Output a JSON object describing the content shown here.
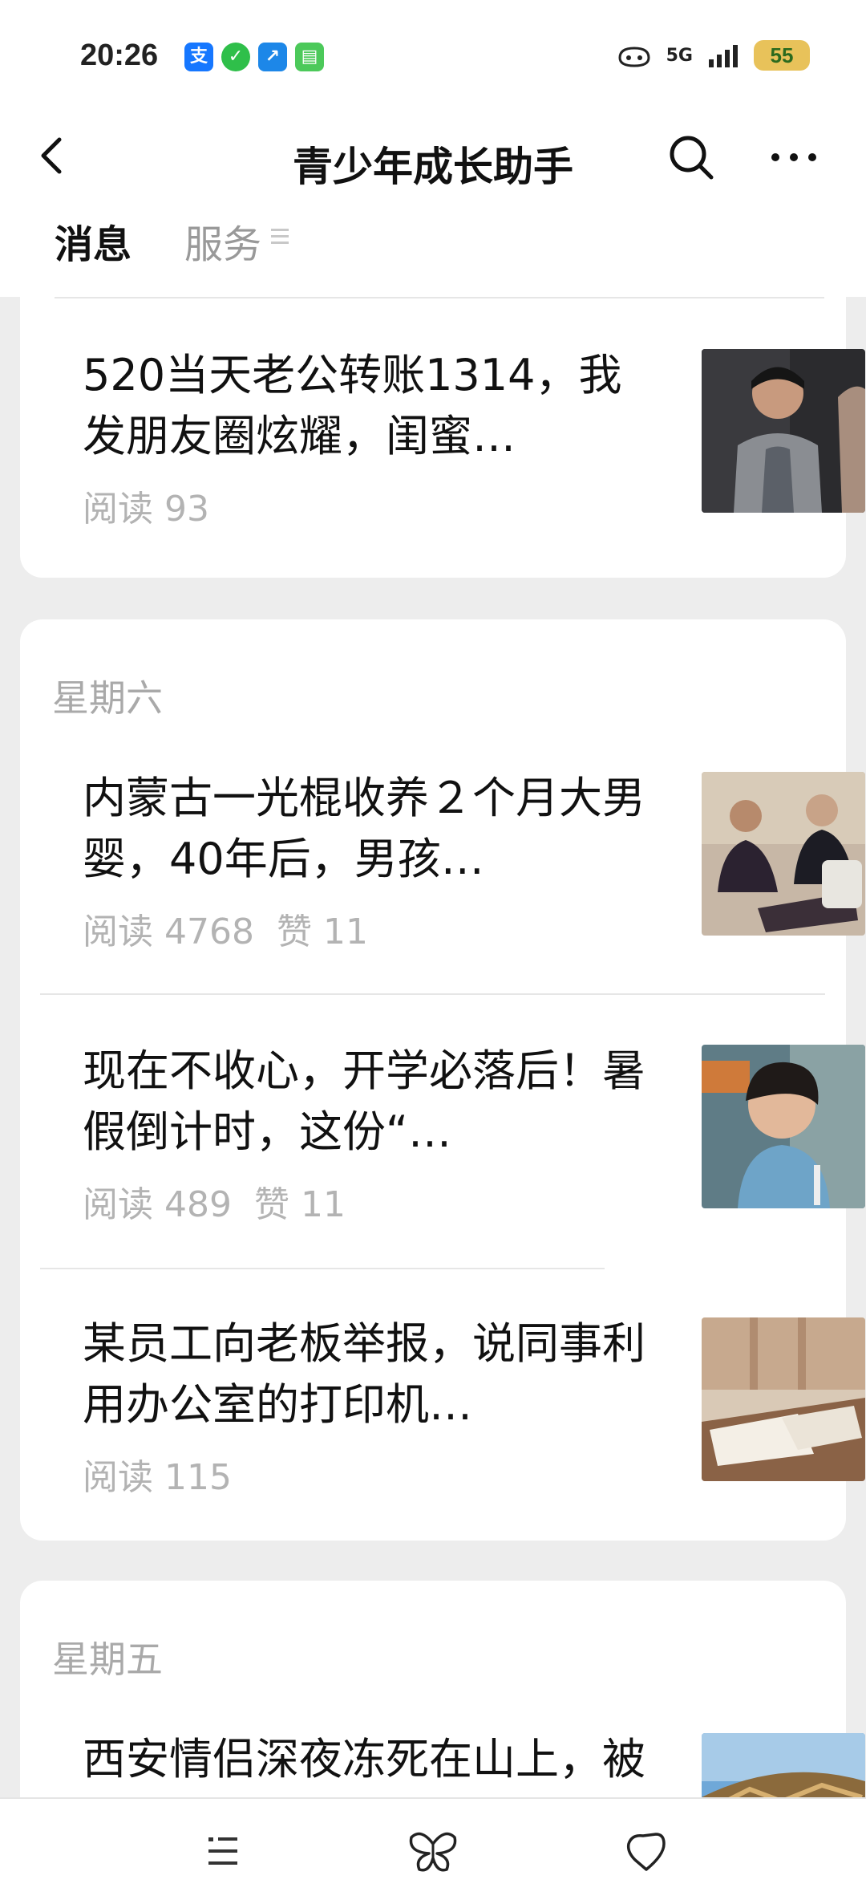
{
  "status_bar": {
    "time": "20:26",
    "apps": [
      {
        "icon": "alipay-icon",
        "glyph": "支",
        "color": "#1677ff"
      },
      {
        "icon": "shield-icon",
        "glyph": "✓",
        "color": "#2fbf4a"
      },
      {
        "icon": "pointer-app-icon",
        "glyph": "↗",
        "color": "#1d87e8"
      },
      {
        "icon": "message-app-icon",
        "glyph": "▤",
        "color": "#4cc95a"
      }
    ],
    "network_label": "5G",
    "battery": "55"
  },
  "nav": {
    "title": "青少年成长助手"
  },
  "tabs": {
    "messages": "消息",
    "services": "服务"
  },
  "cards": [
    {
      "day": "",
      "articles": [
        {
          "title": "520当天老公转账1314，我发朋友圈炫耀，闺蜜…",
          "reads": "阅读 93",
          "likes": "",
          "thumb": "couple-photo"
        }
      ]
    },
    {
      "day": "星期六",
      "articles": [
        {
          "title": "内蒙古一光棍收养２个月大男婴，40年后，男孩…",
          "reads": "阅读 4768",
          "likes": "赞 11",
          "thumb": "elder-and-man-photo"
        },
        {
          "title": "现在不收心，开学必落后！暑假倒计时，这份“…",
          "reads": "阅读 489",
          "likes": "赞 11",
          "thumb": "child-photo"
        },
        {
          "title": "某员工向老板举报，说同事利用办公室的打印机…",
          "reads": "阅读 115",
          "likes": "",
          "thumb": "office-desk-photo"
        }
      ]
    },
    {
      "day": "星期五",
      "articles": [
        {
          "title": "西安情侣深夜冻死在山上，被找到时双手紧握…",
          "reads": "",
          "likes": "",
          "thumb": "mountain-sky-photo"
        }
      ]
    }
  ],
  "bottom_bar": {
    "icons": [
      "list-menu-icon",
      "butterfly-icon",
      "heart-shape-icon"
    ]
  }
}
